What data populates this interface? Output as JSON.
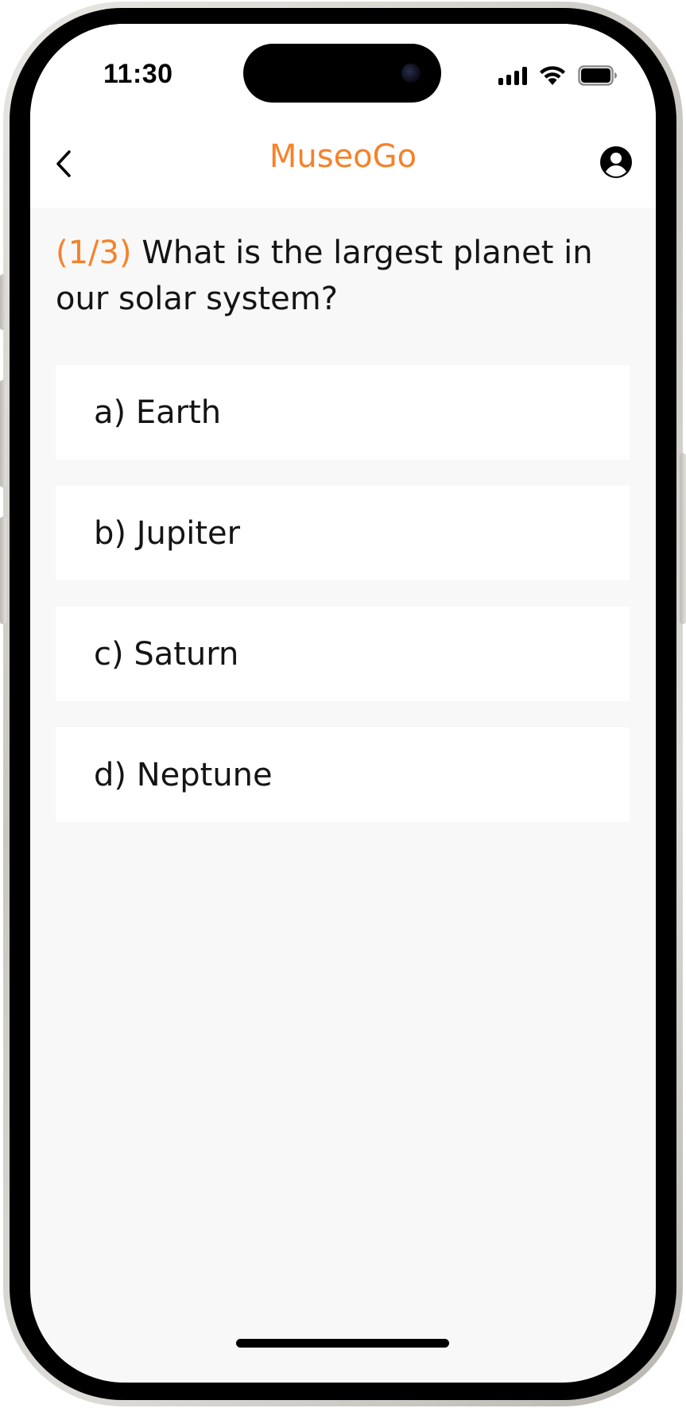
{
  "status_bar": {
    "time": "11:30"
  },
  "header": {
    "title": "MuseoGo",
    "back_icon": "chevron-left-icon",
    "profile_icon": "account-circle-icon"
  },
  "quiz": {
    "progress": "(1/3)",
    "question": "What is the largest planet in our solar system?",
    "options": [
      {
        "label": "a) Earth"
      },
      {
        "label": "b) Jupiter"
      },
      {
        "label": "c) Saturn"
      },
      {
        "label": "d) Neptune"
      }
    ]
  },
  "colors": {
    "accent": "#f5822a",
    "background": "#f8f8f8",
    "card": "#ffffff",
    "text": "#141414"
  }
}
